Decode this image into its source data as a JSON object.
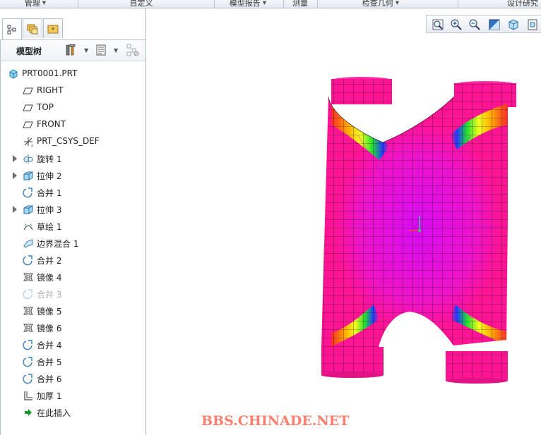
{
  "ribbon": {
    "items": [
      {
        "label": "管理",
        "has_dropdown": true
      },
      {
        "label": "自定义",
        "has_dropdown": false
      },
      {
        "label": "模型报告",
        "has_dropdown": true
      },
      {
        "label": "测量",
        "has_dropdown": false
      },
      {
        "label": "检查几何",
        "has_dropdown": true
      },
      {
        "label": "设计研究",
        "has_dropdown": false
      }
    ]
  },
  "panel_tabs": [
    {
      "name": "model-tree",
      "icon": "tree-structure-icon",
      "active": true
    },
    {
      "name": "folder-browser",
      "icon": "folders-icon",
      "active": false
    },
    {
      "name": "favorites",
      "icon": "favorites-star-icon",
      "active": false
    }
  ],
  "tree_header": {
    "title": "模型树",
    "settings_icon": "tools-icon",
    "show_icon": "list-settings-icon",
    "filter_icon": "tree-filter-icon"
  },
  "model_tree": {
    "items": [
      {
        "label": "PRT0001.PRT",
        "icon": "part-cube-icon",
        "expandable": false,
        "level": 0,
        "suppressed": false
      },
      {
        "label": "RIGHT",
        "icon": "datum-plane-icon",
        "expandable": false,
        "level": 1,
        "suppressed": false
      },
      {
        "label": "TOP",
        "icon": "datum-plane-icon",
        "expandable": false,
        "level": 1,
        "suppressed": false
      },
      {
        "label": "FRONT",
        "icon": "datum-plane-icon",
        "expandable": false,
        "level": 1,
        "suppressed": false
      },
      {
        "label": "PRT_CSYS_DEF",
        "icon": "csys-icon",
        "expandable": false,
        "level": 1,
        "suppressed": false
      },
      {
        "label": "旋转 1",
        "icon": "revolve-icon",
        "expandable": true,
        "level": 1,
        "suppressed": false
      },
      {
        "label": "拉伸 2",
        "icon": "extrude-icon",
        "expandable": true,
        "level": 1,
        "suppressed": false
      },
      {
        "label": "合并 1",
        "icon": "merge-icon",
        "expandable": false,
        "level": 1,
        "suppressed": false
      },
      {
        "label": "拉伸 3",
        "icon": "extrude-icon",
        "expandable": true,
        "level": 1,
        "suppressed": false
      },
      {
        "label": "草绘 1",
        "icon": "sketch-icon",
        "expandable": false,
        "level": 1,
        "suppressed": false
      },
      {
        "label": "边界混合 1",
        "icon": "boundary-blend-icon",
        "expandable": false,
        "level": 1,
        "suppressed": false
      },
      {
        "label": "合并 2",
        "icon": "merge-icon",
        "expandable": false,
        "level": 1,
        "suppressed": false
      },
      {
        "label": "镜像 4",
        "icon": "mirror-icon",
        "expandable": false,
        "level": 1,
        "suppressed": false
      },
      {
        "label": "合并 3",
        "icon": "merge-icon",
        "expandable": false,
        "level": 1,
        "suppressed": true
      },
      {
        "label": "镜像 5",
        "icon": "mirror-icon",
        "expandable": false,
        "level": 1,
        "suppressed": false
      },
      {
        "label": "镜像 6",
        "icon": "mirror-icon",
        "expandable": false,
        "level": 1,
        "suppressed": false
      },
      {
        "label": "合并 4",
        "icon": "merge-icon",
        "expandable": false,
        "level": 1,
        "suppressed": false
      },
      {
        "label": "合并 5",
        "icon": "merge-icon",
        "expandable": false,
        "level": 1,
        "suppressed": false
      },
      {
        "label": "合并 6",
        "icon": "merge-icon",
        "expandable": false,
        "level": 1,
        "suppressed": false
      },
      {
        "label": "加厚 1",
        "icon": "thicken-icon",
        "expandable": false,
        "level": 1,
        "suppressed": false
      },
      {
        "label": "在此插入",
        "icon": "insert-here-arrow-icon",
        "expandable": false,
        "level": 1,
        "suppressed": false
      }
    ]
  },
  "view_toolbar": {
    "buttons": [
      {
        "name": "refit",
        "icon": "zoom-fit-icon"
      },
      {
        "name": "zoom-in",
        "icon": "zoom-in-icon"
      },
      {
        "name": "zoom-out",
        "icon": "zoom-out-icon"
      },
      {
        "name": "repaint",
        "icon": "repaint-icon"
      },
      {
        "name": "display-style",
        "icon": "display-style-cube-icon"
      },
      {
        "name": "saved-orientations",
        "icon": "saved-views-icon"
      }
    ]
  },
  "graphics": {
    "watermark": "BBS.CHINADE.NET",
    "colors": {
      "surface_primary": "#ff1493",
      "surface_center": "#e010f0",
      "mesh_lines": "#1a0a10",
      "watermark": "#ff7f6e"
    }
  }
}
